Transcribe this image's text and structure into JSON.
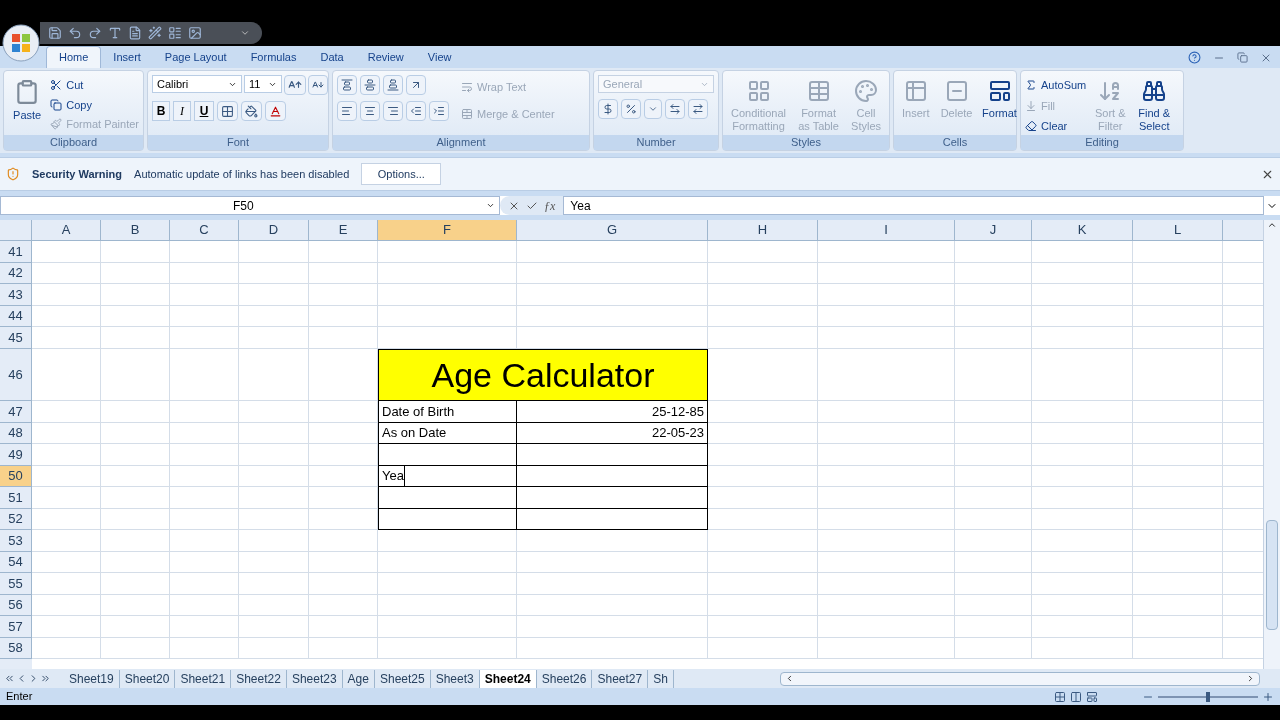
{
  "ribbon_tabs": [
    {
      "label": "Home",
      "selected": true
    },
    {
      "label": "Insert",
      "selected": false
    },
    {
      "label": "Page Layout",
      "selected": false
    },
    {
      "label": "Formulas",
      "selected": false
    },
    {
      "label": "Data",
      "selected": false
    },
    {
      "label": "Review",
      "selected": false
    },
    {
      "label": "View",
      "selected": false
    }
  ],
  "ribbon_groups": [
    {
      "title": "Clipboard",
      "items": [
        {
          "label": "Paste",
          "disabled": false
        },
        {
          "label": "Cut",
          "disabled": false
        },
        {
          "label": "Copy",
          "disabled": false
        },
        {
          "label": "Format Painter",
          "disabled": true
        }
      ]
    },
    {
      "title": "Font",
      "items": [
        {
          "value": "Calibri"
        },
        {
          "value": "11"
        },
        {
          "label": "B"
        },
        {
          "label": "I"
        },
        {
          "label": "U"
        }
      ]
    },
    {
      "title": "Alignment",
      "items": [
        {
          "label": "Wrap Text",
          "disabled": true
        },
        {
          "label": "Merge & Center",
          "disabled": true
        }
      ]
    },
    {
      "title": "Number",
      "items": [
        {
          "value": "General",
          "disabled": true
        }
      ]
    },
    {
      "title": "Styles",
      "items": [
        {
          "label": "Conditional Formatting",
          "disabled": true
        },
        {
          "label": "Format as Table",
          "disabled": true
        },
        {
          "label": "Cell Styles",
          "disabled": true
        }
      ]
    },
    {
      "title": "Cells",
      "items": [
        {
          "label": "Insert",
          "disabled": true
        },
        {
          "label": "Delete",
          "disabled": true
        },
        {
          "label": "Format",
          "disabled": false
        }
      ]
    },
    {
      "title": "Editing",
      "items": [
        {
          "label": "AutoSum",
          "disabled": false
        },
        {
          "label": "Fill",
          "disabled": true
        },
        {
          "label": "Clear",
          "disabled": false
        },
        {
          "label": "Sort & Filter",
          "disabled": true
        },
        {
          "label": "Find & Select",
          "disabled": false
        }
      ]
    }
  ],
  "security_bar": {
    "title": "Security Warning",
    "message": "Automatic update of links has been disabled",
    "button": "Options..."
  },
  "formula_bar": {
    "name_box": "F50",
    "function_button": "ƒx",
    "formula": "Yea"
  },
  "columns": [
    {
      "label": "A",
      "selected": false
    },
    {
      "label": "B",
      "selected": false
    },
    {
      "label": "C",
      "selected": false
    },
    {
      "label": "D",
      "selected": false
    },
    {
      "label": "E",
      "selected": false
    },
    {
      "label": "F",
      "selected": true
    },
    {
      "label": "G",
      "selected": false
    },
    {
      "label": "H",
      "selected": false
    },
    {
      "label": "I",
      "selected": false
    },
    {
      "label": "J",
      "selected": false
    },
    {
      "label": "K",
      "selected": false
    },
    {
      "label": "L",
      "selected": false
    }
  ],
  "rows": [
    {
      "label": "41",
      "selected": false,
      "kind": "plain"
    },
    {
      "label": "42",
      "selected": false,
      "kind": "plain"
    },
    {
      "label": "43",
      "selected": false,
      "kind": "plain"
    },
    {
      "label": "44",
      "selected": false,
      "kind": "plain"
    },
    {
      "label": "45",
      "selected": false,
      "kind": "plain"
    },
    {
      "label": "46",
      "selected": false,
      "kind": "title",
      "cells": {
        "F": "Age Calculator"
      }
    },
    {
      "label": "47",
      "selected": false,
      "kind": "table",
      "cells": {
        "F": "Date of Birth",
        "G": "25-12-85"
      }
    },
    {
      "label": "48",
      "selected": false,
      "kind": "table",
      "cells": {
        "F": "As on Date",
        "G": "22-05-23"
      }
    },
    {
      "label": "49",
      "selected": false,
      "kind": "table"
    },
    {
      "label": "50",
      "selected": true,
      "kind": "table",
      "editing": true,
      "cells": {
        "F": "Yea"
      }
    },
    {
      "label": "51",
      "selected": false,
      "kind": "table"
    },
    {
      "label": "52",
      "selected": false,
      "kind": "table"
    },
    {
      "label": "53",
      "selected": false,
      "kind": "plain"
    },
    {
      "label": "54",
      "selected": false,
      "kind": "plain"
    },
    {
      "label": "55",
      "selected": false,
      "kind": "plain"
    },
    {
      "label": "56",
      "selected": false,
      "kind": "plain"
    },
    {
      "label": "57",
      "selected": false,
      "kind": "plain"
    },
    {
      "label": "58",
      "selected": false,
      "kind": "plain"
    }
  ],
  "sheet_tabs": [
    {
      "label": "Sheet19",
      "selected": false
    },
    {
      "label": "Sheet20",
      "selected": false
    },
    {
      "label": "Sheet21",
      "selected": false
    },
    {
      "label": "Sheet22",
      "selected": false
    },
    {
      "label": "Sheet23",
      "selected": false
    },
    {
      "label": "Age",
      "selected": false
    },
    {
      "label": "Sheet25",
      "selected": false
    },
    {
      "label": "Sheet3",
      "selected": false
    },
    {
      "label": "Sheet24",
      "selected": true
    },
    {
      "label": "Sheet26",
      "selected": false
    },
    {
      "label": "Sheet27",
      "selected": false
    },
    {
      "label": "Sh",
      "selected": false
    }
  ],
  "status_bar": {
    "mode": "Enter",
    "zoom": {
      "level": 0.5
    }
  }
}
